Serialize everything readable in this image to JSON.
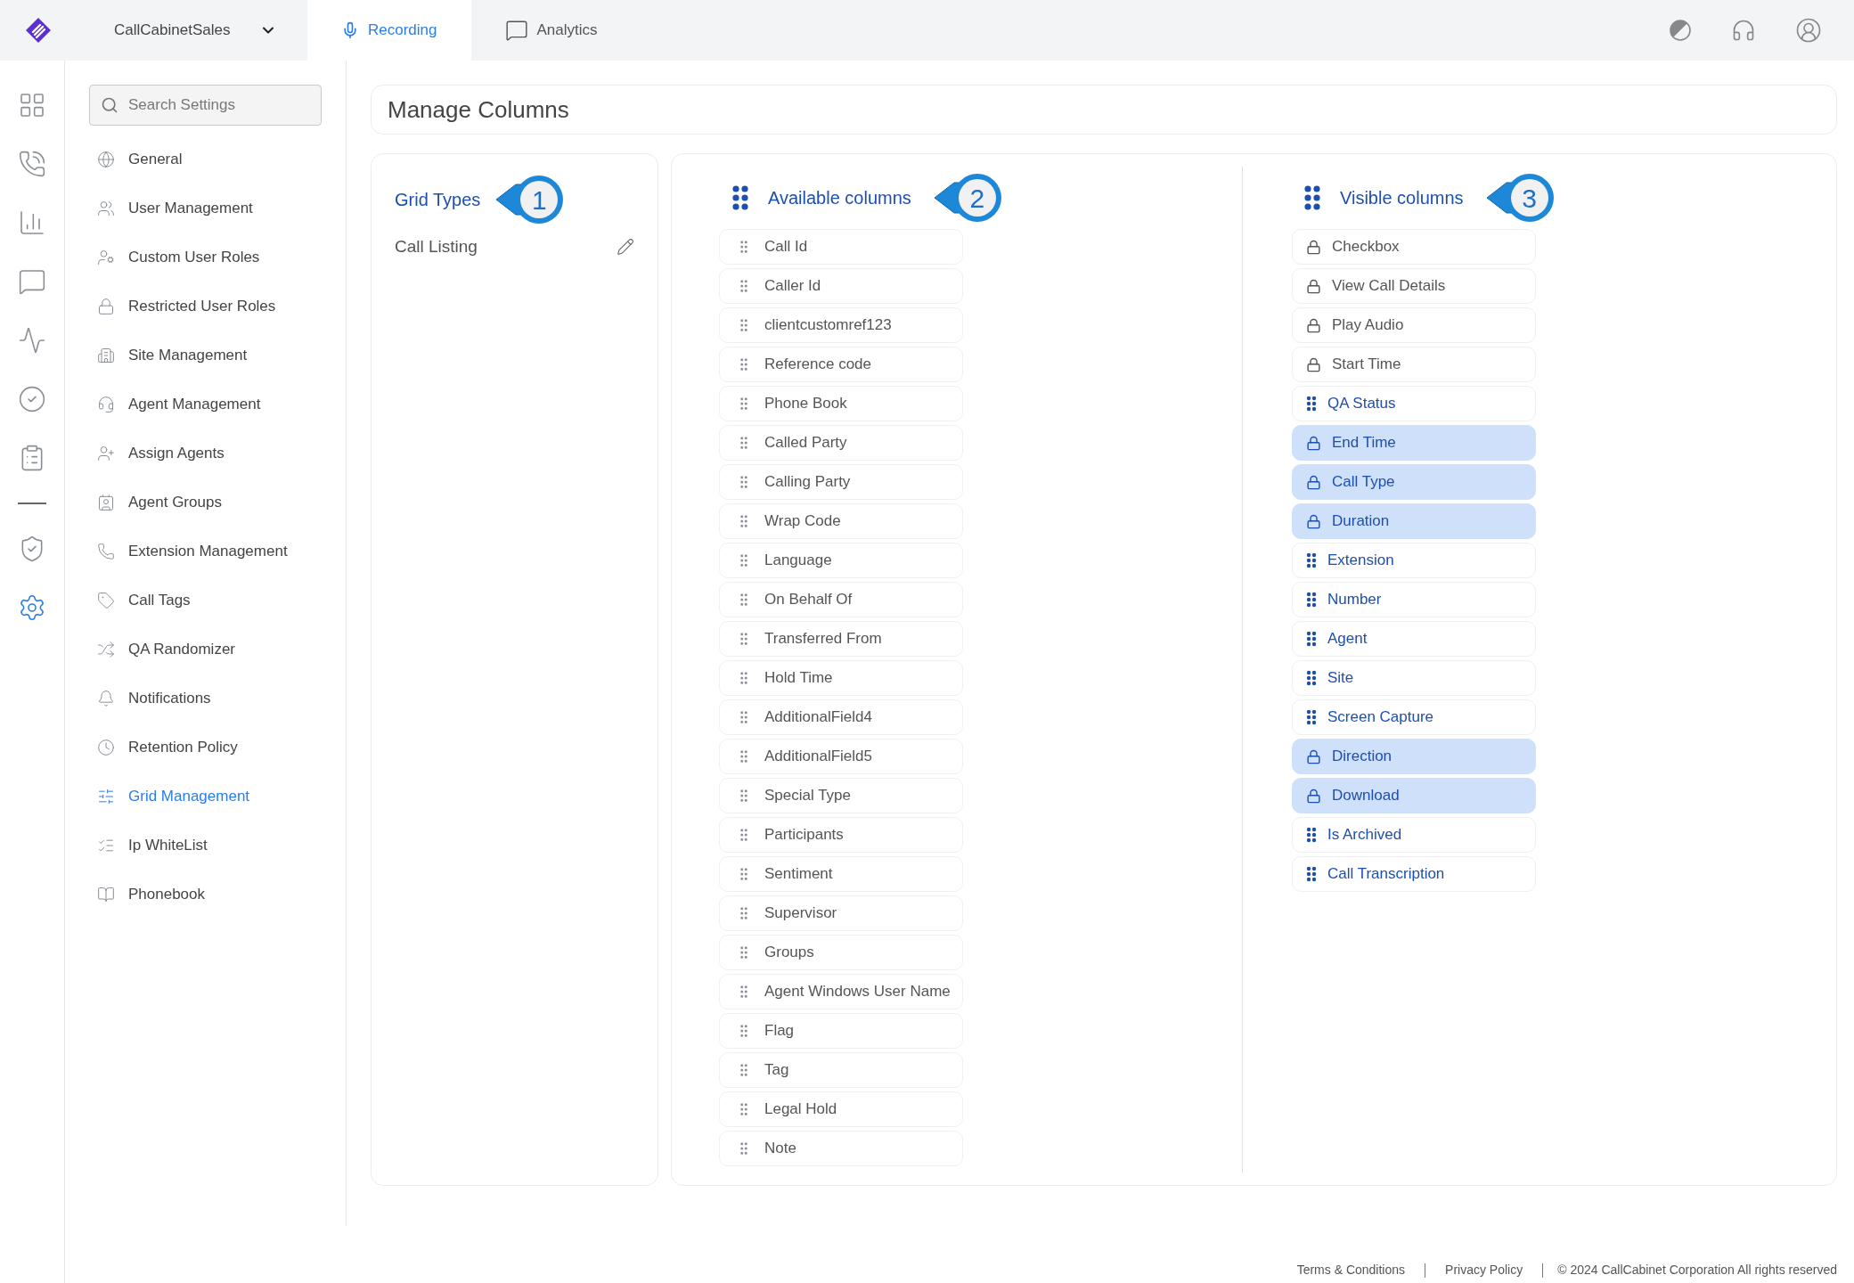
{
  "top_bar": {
    "account": "CallCabinetSales",
    "tabs": [
      {
        "label": "Recording",
        "selected": true
      },
      {
        "label": "Analytics",
        "selected": false
      }
    ]
  },
  "rail": [
    {
      "selected": false
    },
    {
      "selected": false
    },
    {
      "selected": false
    },
    {
      "selected": false
    },
    {
      "selected": false
    },
    {
      "selected": false
    },
    {
      "selected": false
    },
    {
      "selected": false
    },
    {
      "selected": true
    }
  ],
  "sidebar": {
    "search": {
      "placeholder": "Search Settings"
    },
    "items": [
      {
        "label": "General",
        "selected": false
      },
      {
        "label": "User Management",
        "selected": false
      },
      {
        "label": "Custom User Roles",
        "selected": false
      },
      {
        "label": "Restricted User Roles",
        "selected": false
      },
      {
        "label": "Site Management",
        "selected": false
      },
      {
        "label": "Agent Management",
        "selected": false
      },
      {
        "label": "Assign Agents",
        "selected": false
      },
      {
        "label": "Agent Groups",
        "selected": false
      },
      {
        "label": "Extension Management",
        "selected": false
      },
      {
        "label": "Call Tags",
        "selected": false
      },
      {
        "label": "QA Randomizer",
        "selected": false
      },
      {
        "label": "Notifications",
        "selected": false
      },
      {
        "label": "Retention Policy",
        "selected": false
      },
      {
        "label": "Grid Management",
        "selected": true
      },
      {
        "label": "Ip WhiteList",
        "selected": false
      },
      {
        "label": "Phonebook",
        "selected": false
      }
    ]
  },
  "page_title": "Manage Columns",
  "grid_types": {
    "title": "Grid Types",
    "callout": "1",
    "items": [
      "Call Listing"
    ]
  },
  "available_columns": {
    "title": "Available columns",
    "callout": "2",
    "items": [
      "Call Id",
      "Caller Id",
      "clientcustomref123",
      "Reference code",
      "Phone Book",
      "Called Party",
      "Calling Party",
      "Wrap Code",
      "Language",
      "On Behalf Of",
      "Transferred From",
      "Hold Time",
      "AdditionalField4",
      "AdditionalField5",
      "Special Type",
      "Participants",
      "Sentiment",
      "Supervisor",
      "Groups",
      "Agent Windows User Name",
      "Flag",
      "Tag",
      "Legal Hold",
      "Note"
    ]
  },
  "visible_columns": {
    "title": "Visible columns",
    "callout": "3",
    "items": [
      {
        "label": "Checkbox",
        "kind": "locked",
        "selected": false
      },
      {
        "label": "View Call Details",
        "kind": "locked",
        "selected": false
      },
      {
        "label": "Play Audio",
        "kind": "locked",
        "selected": false
      },
      {
        "label": "Start Time",
        "kind": "locked",
        "selected": false
      },
      {
        "label": "QA Status",
        "kind": "draggable",
        "selected": false
      },
      {
        "label": "End Time",
        "kind": "locked",
        "selected": true
      },
      {
        "label": "Call Type",
        "kind": "locked",
        "selected": true
      },
      {
        "label": "Duration",
        "kind": "locked",
        "selected": true
      },
      {
        "label": "Extension",
        "kind": "draggable",
        "selected": false
      },
      {
        "label": "Number",
        "kind": "draggable",
        "selected": false
      },
      {
        "label": "Agent",
        "kind": "draggable",
        "selected": false
      },
      {
        "label": "Site",
        "kind": "draggable",
        "selected": false
      },
      {
        "label": "Screen Capture",
        "kind": "draggable",
        "selected": false
      },
      {
        "label": "Direction",
        "kind": "locked",
        "selected": true
      },
      {
        "label": "Download",
        "kind": "locked",
        "selected": true
      },
      {
        "label": "Is Archived",
        "kind": "draggable",
        "selected": false
      },
      {
        "label": "Call Transcription",
        "kind": "draggable",
        "selected": false
      }
    ]
  },
  "footer": {
    "links": [
      "Terms & Conditions",
      "Privacy Policy"
    ],
    "copyright": "© 2024 CallCabinet Corporation All rights reserved"
  }
}
